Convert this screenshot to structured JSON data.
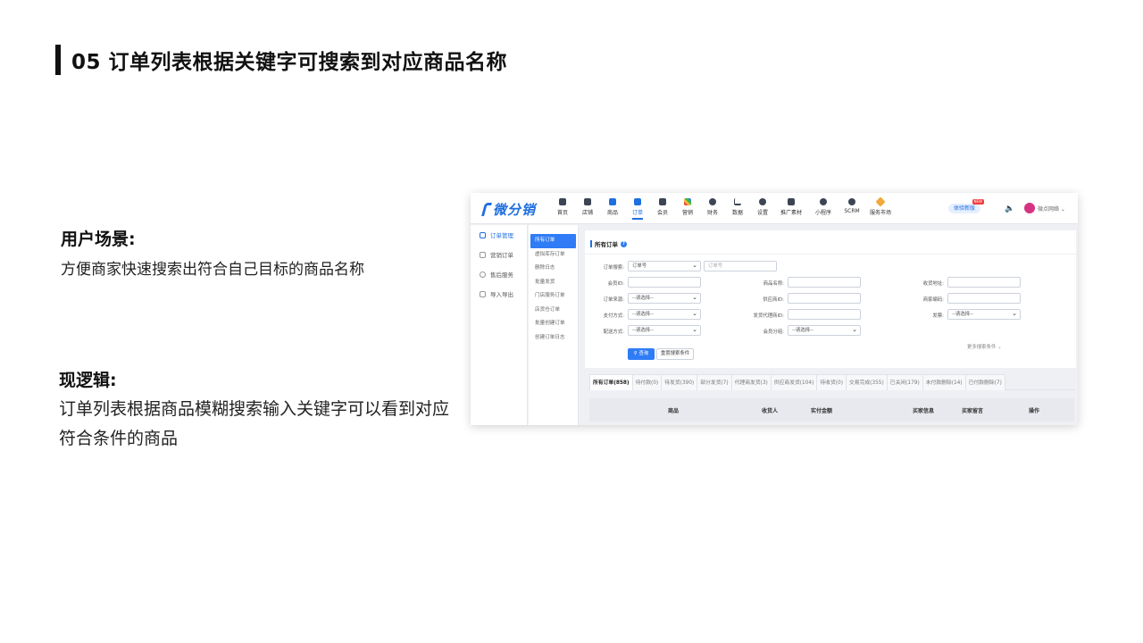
{
  "slide": {
    "title": "05  订单列表根据关键字可搜索到对应商品名称",
    "scene_heading": "用户场景:",
    "scene_text": "方便商家快速搜索出符合自己目标的商品名称",
    "logic_heading": "现逻辑:",
    "logic_text": "订单列表根据商品模糊搜索输入关键字可以看到对应符合条件的商品"
  },
  "app": {
    "logo": "微分销",
    "nav": [
      {
        "label": "首页",
        "icon": "home-icon"
      },
      {
        "label": "店铺",
        "icon": "store-icon"
      },
      {
        "label": "商品",
        "icon": "goods-icon"
      },
      {
        "label": "订单",
        "icon": "order-icon",
        "active": true
      },
      {
        "label": "会员",
        "icon": "member-icon"
      },
      {
        "label": "营销",
        "icon": "marketing-icon"
      },
      {
        "label": "财务",
        "icon": "finance-icon"
      },
      {
        "label": "数据",
        "icon": "data-icon"
      },
      {
        "label": "设置",
        "icon": "settings-icon"
      },
      {
        "label": "推广素材",
        "icon": "share-icon"
      },
      {
        "label": "小程序",
        "icon": "miniapp-icon"
      },
      {
        "label": "SCRM",
        "icon": "scrm-icon"
      },
      {
        "label": "服务市场",
        "icon": "market-icon"
      }
    ],
    "trial_label": "体验新版",
    "trial_badge": "NEW",
    "store_name": "微点网络",
    "sidebar_primary": [
      "订单管理",
      "营销订单",
      "售后服务",
      "导入导出"
    ],
    "sidebar_secondary": [
      "所有订单",
      "虚拟库存订单",
      "删除日志",
      "批量发货",
      "门店服务订单",
      "店货仓订单",
      "批量创建订单",
      "创建订单日志"
    ],
    "panel_title": "所有订单",
    "help_glyph": "?",
    "form": {
      "order_search_label": "订单搜索:",
      "order_search_type": "订单号",
      "order_search_placeholder": "订单号",
      "member_id_label": "会员ID:",
      "goods_name_label": "商品名称:",
      "receiver_address_label": "收货地址:",
      "order_source_label": "订单来源:",
      "supplier_id_label": "供应商ID:",
      "merchant_code_label": "商家编码:",
      "pay_method_label": "支付方式:",
      "agent_id_label": "发货代理商ID:",
      "invoice_label": "发票:",
      "delivery_method_label": "配送方式:",
      "member_group_label": "会员分组:",
      "select_placeholder": "--请选择--",
      "query_button": "查询",
      "reset_button": "重置搜索条件",
      "more_conditions": "更多搜索条件"
    },
    "tabs": [
      "所有订单(858)",
      "待付款(0)",
      "待发货(390)",
      "部分发货(7)",
      "代理商发货(3)",
      "供应商发货(104)",
      "待收货(0)",
      "交易完成(355)",
      "已关闭(179)",
      "未付款删除(14)",
      "已付款删除(7)"
    ],
    "table_headers": [
      "商品",
      "收货人",
      "实付金额",
      "买家信息",
      "买家留言",
      "操作"
    ]
  }
}
